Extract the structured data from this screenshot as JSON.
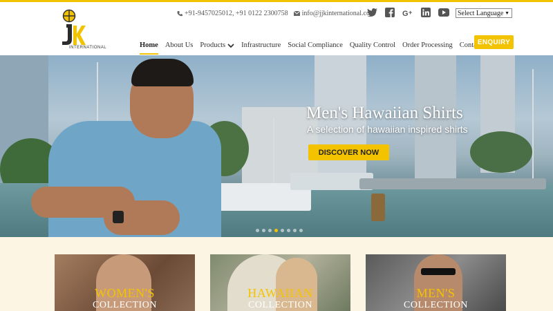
{
  "header": {
    "logo_text": "INTERNATIONAL",
    "logo_letters": "JK",
    "phone": "+91-9457025012, +91 0122 2300758",
    "email": "info@jjkinternational.com",
    "language": "Select Language"
  },
  "social": [
    "twitter-icon",
    "facebook-icon",
    "google-plus-icon",
    "linkedin-icon",
    "youtube-icon"
  ],
  "nav": {
    "items": [
      {
        "label": "Home"
      },
      {
        "label": "About Us"
      },
      {
        "label": "Products"
      },
      {
        "label": "Infrastructure"
      },
      {
        "label": "Social Compliance"
      },
      {
        "label": "Quality Control"
      },
      {
        "label": "Order Processing"
      },
      {
        "label": "Contact us"
      }
    ],
    "enquiry": "ENQUIRY"
  },
  "hero": {
    "title": "Men's Hawaiian Shirts",
    "subtitle": "A selection of hawaiian inspired shirts",
    "button": "DISCOVER NOW",
    "active_slide": 4,
    "slide_count": 8
  },
  "collections": [
    {
      "line1": "WOMEN'S",
      "line2": "COLLECTION"
    },
    {
      "line1": "HAWAIIAN",
      "line2": "COLLECTION"
    },
    {
      "line1": "MEN'S",
      "line2": "COLLECTION"
    }
  ],
  "colors": {
    "accent": "#f3c300",
    "text": "#333333"
  }
}
